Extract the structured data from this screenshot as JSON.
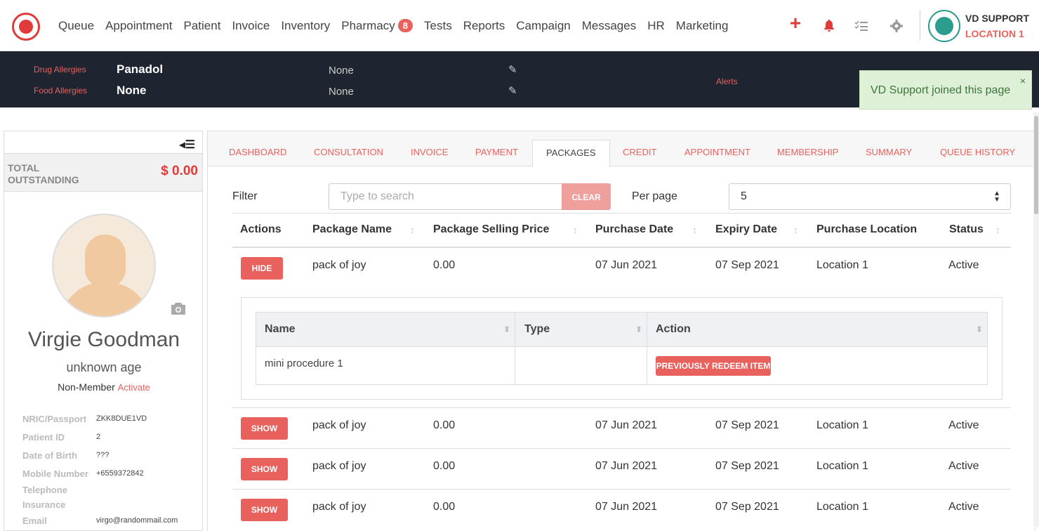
{
  "nav": {
    "items": [
      "Queue",
      "Appointment",
      "Patient",
      "Invoice",
      "Inventory",
      "Pharmacy",
      "Tests",
      "Reports",
      "Campaign",
      "Messages",
      "HR",
      "Marketing"
    ],
    "pharmacy_badge": "8"
  },
  "user": {
    "name": "VD SUPPORT",
    "location": "LOCATION 1"
  },
  "allergies": {
    "drug_label": "Drug Allergies",
    "drug_value": "Panadol",
    "drug_note": "None",
    "food_label": "Food Allergies",
    "food_value": "None",
    "food_note": "None",
    "alerts_label": "Alerts"
  },
  "toast": {
    "message": "VD Support joined this page",
    "close": "×"
  },
  "sidebar": {
    "outstanding_label": "TOTAL OUTSTANDING",
    "outstanding_value": "$ 0.00",
    "patient_name": "Virgie Goodman",
    "age": "unknown age",
    "membership": "Non-Member",
    "activate": "Activate",
    "info": [
      {
        "label": "NRIC/Passport",
        "value": "ZKK8DUE1VD"
      },
      {
        "label": "Patient ID",
        "value": "2"
      },
      {
        "label": "Date of Birth",
        "value": "???"
      },
      {
        "label": "Mobile Number",
        "value": "+6559372842"
      },
      {
        "label": "Telephone",
        "value": ""
      },
      {
        "label": "Insurance",
        "value": ""
      },
      {
        "label": "Email",
        "value": "virgo@randommail.com"
      }
    ]
  },
  "tabs": [
    "DASHBOARD",
    "CONSULTATION",
    "INVOICE",
    "PAYMENT",
    "PACKAGES",
    "CREDIT",
    "APPOINTMENT",
    "MEMBERSHIP",
    "SUMMARY",
    "QUEUE HISTORY"
  ],
  "active_tab": "PACKAGES",
  "filter": {
    "label": "Filter",
    "placeholder": "Type to search",
    "clear": "CLEAR",
    "perpage_label": "Per page",
    "perpage_value": "5"
  },
  "table": {
    "headers": [
      "Actions",
      "Package Name",
      "Package Selling Price",
      "Purchase Date",
      "Expiry Date",
      "Purchase Location",
      "Status"
    ],
    "rows": [
      {
        "action": "HIDE",
        "name": "pack of joy",
        "price": "0.00",
        "purchase": "07 Jun 2021",
        "expiry": "07 Sep 2021",
        "location": "Location 1",
        "status": "Active"
      },
      {
        "action": "SHOW",
        "name": "pack of joy",
        "price": "0.00",
        "purchase": "07 Jun 2021",
        "expiry": "07 Sep 2021",
        "location": "Location 1",
        "status": "Active"
      },
      {
        "action": "SHOW",
        "name": "pack of joy",
        "price": "0.00",
        "purchase": "07 Jun 2021",
        "expiry": "07 Sep 2021",
        "location": "Location 1",
        "status": "Active"
      },
      {
        "action": "SHOW",
        "name": "pack of joy",
        "price": "0.00",
        "purchase": "07 Jun 2021",
        "expiry": "07 Sep 2021",
        "location": "Location 1",
        "status": "Active"
      }
    ]
  },
  "subtable": {
    "headers": [
      "Name",
      "Type",
      "Action"
    ],
    "row": {
      "name": "mini procedure 1",
      "type": "",
      "action": "PREVIOUSLY REDEEM ITEM"
    }
  },
  "colors": {
    "accent": "#e8615c",
    "dark_band": "#1e2430",
    "toast_bg": "#dff0d8"
  },
  "icons": [
    "logo-icon",
    "plus-icon",
    "bell-icon",
    "checklist-icon",
    "gear-icon",
    "user-avatar-icon",
    "edit-icon",
    "close-icon",
    "collapse-menu-icon",
    "camera-icon",
    "sort-icon",
    "caret-icon"
  ]
}
